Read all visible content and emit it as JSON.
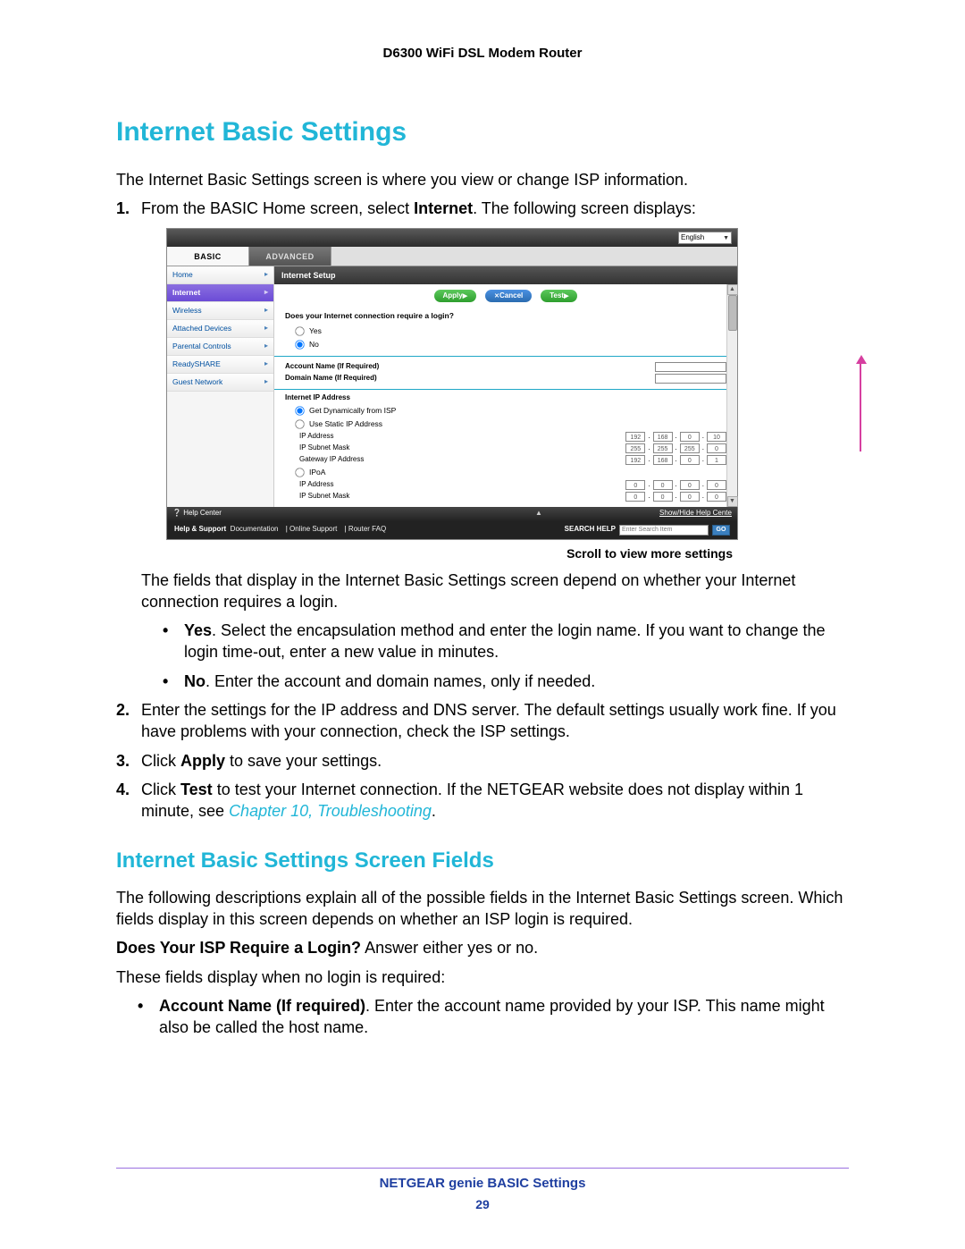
{
  "header": {
    "product": "D6300 WiFi DSL Modem Router"
  },
  "h1": "Internet Basic Settings",
  "intro": "The Internet Basic Settings screen is where you view or change ISP information.",
  "steps": {
    "s1_pre": "From the BASIC Home screen, select ",
    "s1_bold": "Internet",
    "s1_post": ". The following screen displays:",
    "s2": "Enter the settings for the IP address and DNS server. The default settings usually work fine. If you have problems with your connection, check the ISP settings.",
    "s3_pre": "Click ",
    "s3_bold": "Apply",
    "s3_post": " to save your settings.",
    "s4_pre": "Click ",
    "s4_bold": "Test",
    "s4_mid": " to test your Internet connection. If the NETGEAR website does not display within 1 minute, see ",
    "s4_link": "Chapter 10, Troubleshooting",
    "s4_end": "."
  },
  "depend_text": "The fields that display in the Internet Basic Settings screen depend on whether your Internet connection requires a login.",
  "bullets": {
    "yes_b": "Yes",
    "yes_t": ". Select the encapsulation method and enter the login name. If you want to change the login time-out, enter a new value in minutes.",
    "no_b": "No",
    "no_t": ". Enter the account and domain names, only if needed."
  },
  "h2": "Internet Basic Settings Screen Fields",
  "fields_intro": "The following descriptions explain all of the possible fields in the Internet Basic Settings screen. Which fields display in this screen depends on whether an ISP login is required.",
  "isp_q_b": "Does Your ISP Require a Login?",
  "isp_q_t": " Answer either yes or no.",
  "nologin_intro": "These fields display when no login is required:",
  "acct_b": "Account Name (If required)",
  "acct_t": ". Enter the account name provided by your ISP. This name might also be called the host name.",
  "scroll_caption": "Scroll to view more settings",
  "footer": {
    "section": "NETGEAR genie BASIC Settings",
    "page": "29"
  },
  "shot": {
    "language": "English",
    "tabs": {
      "basic": "BASIC",
      "advanced": "ADVANCED"
    },
    "sidebar": [
      "Home",
      "Internet",
      "Wireless",
      "Attached Devices",
      "Parental Controls",
      "ReadySHARE",
      "Guest Network"
    ],
    "active_sidebar_index": 1,
    "pane_title": "Internet Setup",
    "buttons": {
      "apply": "Apply",
      "cancel": "Cancel",
      "test": "Test"
    },
    "login_q": "Does your Internet connection require a login?",
    "radio_yes": "Yes",
    "radio_no": "No",
    "account_label": "Account Name  (If Required)",
    "domain_label": "Domain Name  (If Required)",
    "ip_header": "Internet IP Address",
    "ip_dyn": "Get Dynamically from ISP",
    "ip_static": "Use Static IP Address",
    "ip_addr_label": "IP Address",
    "subnet_label": "IP Subnet Mask",
    "gateway_label": "Gateway IP Address",
    "ipoa_label": "IPoA",
    "ip_addr": [
      "192",
      "168",
      "0",
      "10"
    ],
    "subnet": [
      "255",
      "255",
      "255",
      "0"
    ],
    "gateway": [
      "192",
      "168",
      "0",
      "1"
    ],
    "zeros": [
      "0",
      "0",
      "0",
      "0"
    ],
    "help_center": "Help Center",
    "show_hide": "Show/Hide Help Cente",
    "footer_left_bold": "Help & Support",
    "footer_links": [
      "Documentation",
      "Online Support",
      "Router FAQ"
    ],
    "search_label": "SEARCH HELP",
    "search_placeholder": "Enter Search Item",
    "go": "GO"
  }
}
